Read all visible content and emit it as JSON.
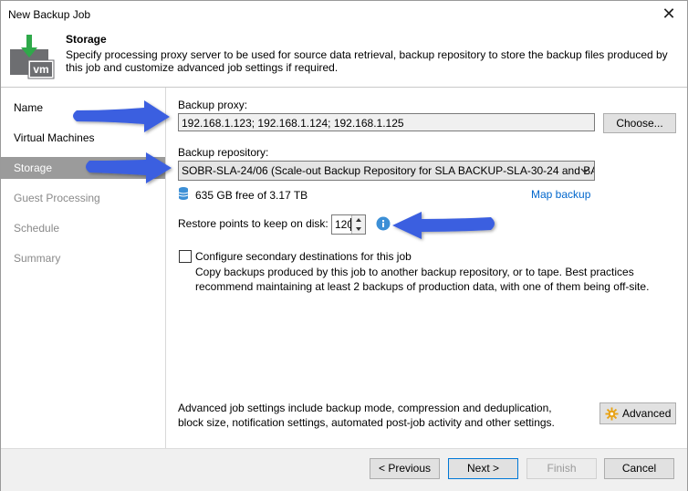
{
  "window": {
    "title": "New Backup Job",
    "close_glyph": "✕"
  },
  "header": {
    "title": "Storage",
    "description": "Specify processing proxy server to be used for source data retrieval, backup repository to store the backup files produced by this job and customize advanced job settings if required.",
    "icon": "vm-download-icon",
    "icon_label": "vm"
  },
  "sidebar": {
    "items": [
      {
        "label": "Name",
        "state": "normal"
      },
      {
        "label": "Virtual Machines",
        "state": "normal"
      },
      {
        "label": "Storage",
        "state": "active"
      },
      {
        "label": "Guest Processing",
        "state": "disabled"
      },
      {
        "label": "Schedule",
        "state": "disabled"
      },
      {
        "label": "Summary",
        "state": "disabled"
      }
    ]
  },
  "storage": {
    "proxy_label": "Backup proxy:",
    "proxy_value": "192.168.1.123; 192.168.1.124; 192.168.1.125",
    "choose_button": "Choose...",
    "repository_label": "Backup repository:",
    "repository_value": "SOBR-SLA-24/06 (Scale-out Backup Repository for SLA BACKUP-SLA-30-24 and BA",
    "free_space": "635 GB free of 3.17 TB",
    "map_backup": "Map backup",
    "restore_points_label": "Restore points to keep on disk:",
    "restore_points_value": "120",
    "secondary_label": "Configure secondary destinations for this job",
    "secondary_checked": false,
    "secondary_desc_line1": "Copy backups produced by this job to another backup repository, or to tape. Best practices",
    "secondary_desc_line2": "recommend maintaining at least 2 backups of production data, with one of them being off-site.",
    "advanced_desc_line1": "Advanced job settings include backup mode, compression and deduplication,",
    "advanced_desc_line2": "block size, notification settings, automated post-job activity and other settings.",
    "advanced_button": "Advanced"
  },
  "footer": {
    "previous": "< Previous",
    "next": "Next >",
    "finish": "Finish",
    "cancel": "Cancel"
  },
  "colors": {
    "active_nav": "#9b9b9b",
    "link": "#0066cc",
    "annotation_arrow": "#3a5fe0",
    "info_icon": "#3c8fd6",
    "vm_icon_green": "#2fa94a",
    "vm_icon_gray": "#6d6e71"
  }
}
